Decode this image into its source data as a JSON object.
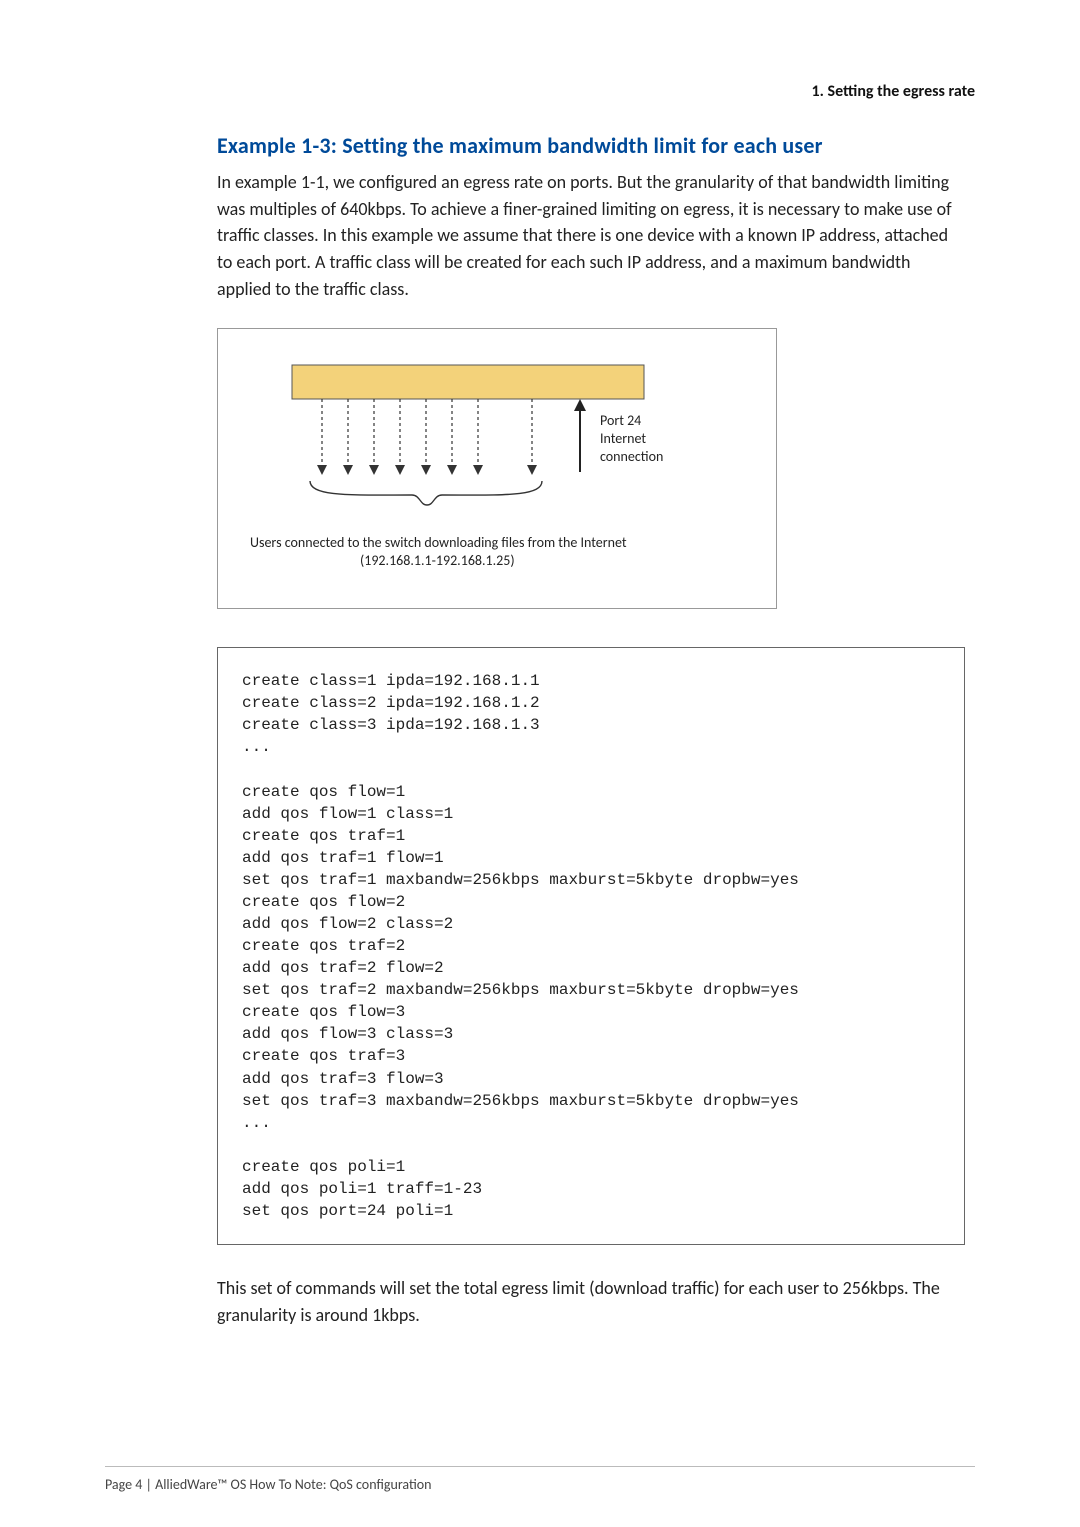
{
  "header": {
    "running_title": "1. Setting the egress rate"
  },
  "heading": "Example 1-3: Setting the maximum bandwidth limit for each user",
  "intro": "In example 1-1, we configured an egress rate on ports. But the granularity of that bandwidth limiting was multiples of 640kbps. To achieve a finer-grained limiting on egress, it is necessary to make use of traffic classes. In this example we assume that there is one device with a known IP address, attached to each port. A traffic class will be created for each such IP address, and a maximum bandwidth applied to the traffic class.",
  "diagram": {
    "port_label_line1": "Port 24",
    "port_label_line2": "Internet",
    "port_label_line3": "connection",
    "caption_line1": "Users connected to the switch downloading files from the Internet",
    "caption_line2": "(192.168.1.1-192.168.1.25)"
  },
  "code": "create class=1 ipda=192.168.1.1\ncreate class=2 ipda=192.168.1.2\ncreate class=3 ipda=192.168.1.3\n...\n\ncreate qos flow=1\nadd qos flow=1 class=1\ncreate qos traf=1\nadd qos traf=1 flow=1\nset qos traf=1 maxbandw=256kbps maxburst=5kbyte dropbw=yes\ncreate qos flow=2\nadd qos flow=2 class=2\ncreate qos traf=2\nadd qos traf=2 flow=2\nset qos traf=2 maxbandw=256kbps maxburst=5kbyte dropbw=yes\ncreate qos flow=3\nadd qos flow=3 class=3\ncreate qos traf=3\nadd qos traf=3 flow=3\nset qos traf=3 maxbandw=256kbps maxburst=5kbyte dropbw=yes\n...\n\ncreate qos poli=1\nadd qos poli=1 traff=1-23\nset qos port=24 poli=1",
  "closing": "This set of commands will set the total egress limit (download traffic) for each user to 256kbps. The granularity is around 1kbps.",
  "footer": "Page 4 | AlliedWare™ OS How To Note: QoS configuration"
}
